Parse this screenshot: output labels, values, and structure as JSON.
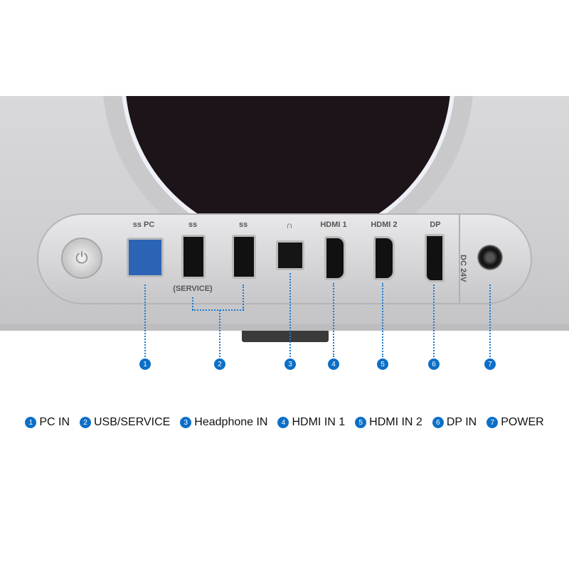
{
  "ports": [
    {
      "num": "1",
      "label_top": "ss PC",
      "legend": "PC IN"
    },
    {
      "num": "2",
      "label_top": "ss",
      "label_bottom": "(SERVICE)",
      "legend": "USB/SERVICE"
    },
    {
      "num": "3",
      "label_top": "∩",
      "legend": "Headphone IN"
    },
    {
      "num": "4",
      "label_top": "HDMI 1",
      "legend": "HDMI IN 1"
    },
    {
      "num": "5",
      "label_top": "HDMI 2",
      "legend": "HDMI IN 2"
    },
    {
      "num": "6",
      "label_top": "DP",
      "legend": "DP IN"
    },
    {
      "num": "7",
      "label_top": "DC 24V",
      "legend": "POWER"
    }
  ],
  "second_usb_label": "ss",
  "accent": "#0c6fc7"
}
